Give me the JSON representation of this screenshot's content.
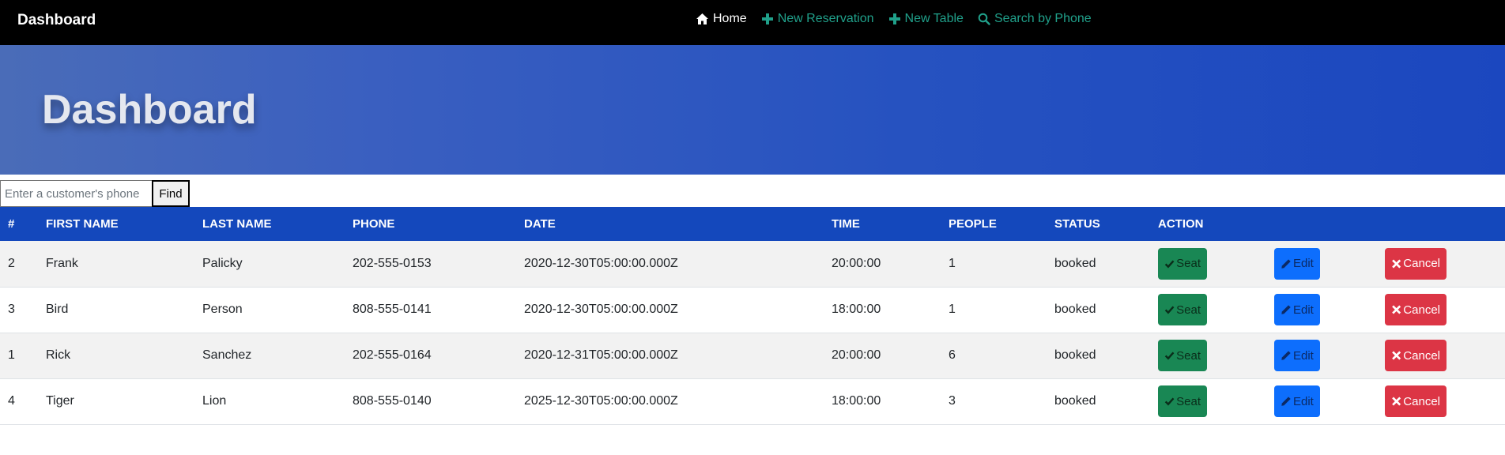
{
  "nav": {
    "brand": "Dashboard",
    "links": [
      {
        "label": "Home",
        "icon": "home-icon"
      },
      {
        "label": "New Reservation",
        "icon": "plus-icon"
      },
      {
        "label": "New Table",
        "icon": "plus-icon"
      },
      {
        "label": "Search by Phone",
        "icon": "search-icon"
      }
    ]
  },
  "hero": {
    "title": "Dashboard"
  },
  "search": {
    "placeholder": "Enter a customer's phone",
    "button": "Find"
  },
  "table": {
    "headers": [
      "#",
      "FIRST NAME",
      "LAST NAME",
      "PHONE",
      "DATE",
      "TIME",
      "PEOPLE",
      "STATUS",
      "ACTION"
    ],
    "rows": [
      {
        "id": "2",
        "first": "Frank",
        "last": "Palicky",
        "phone": "202-555-0153",
        "date": "2020-12-30T05:00:00.000Z",
        "time": "20:00:00",
        "people": "1",
        "status": "booked"
      },
      {
        "id": "3",
        "first": "Bird",
        "last": "Person",
        "phone": "808-555-0141",
        "date": "2020-12-30T05:00:00.000Z",
        "time": "18:00:00",
        "people": "1",
        "status": "booked"
      },
      {
        "id": "1",
        "first": "Rick",
        "last": "Sanchez",
        "phone": "202-555-0164",
        "date": "2020-12-31T05:00:00.000Z",
        "time": "20:00:00",
        "people": "6",
        "status": "booked"
      },
      {
        "id": "4",
        "first": "Tiger",
        "last": "Lion",
        "phone": "808-555-0140",
        "date": "2025-12-30T05:00:00.000Z",
        "time": "18:00:00",
        "people": "3",
        "status": "booked"
      }
    ],
    "actions": {
      "seat": "Seat",
      "edit": "Edit",
      "cancel": "Cancel"
    }
  },
  "colors": {
    "navbar": "#000000",
    "nav_link": "#20a08a",
    "hero_start": "#4a6cb8",
    "hero_end": "#1b47bf",
    "table_header": "#1448bc",
    "seat": "#198754",
    "edit": "#0d6efd",
    "cancel": "#dc3545"
  }
}
